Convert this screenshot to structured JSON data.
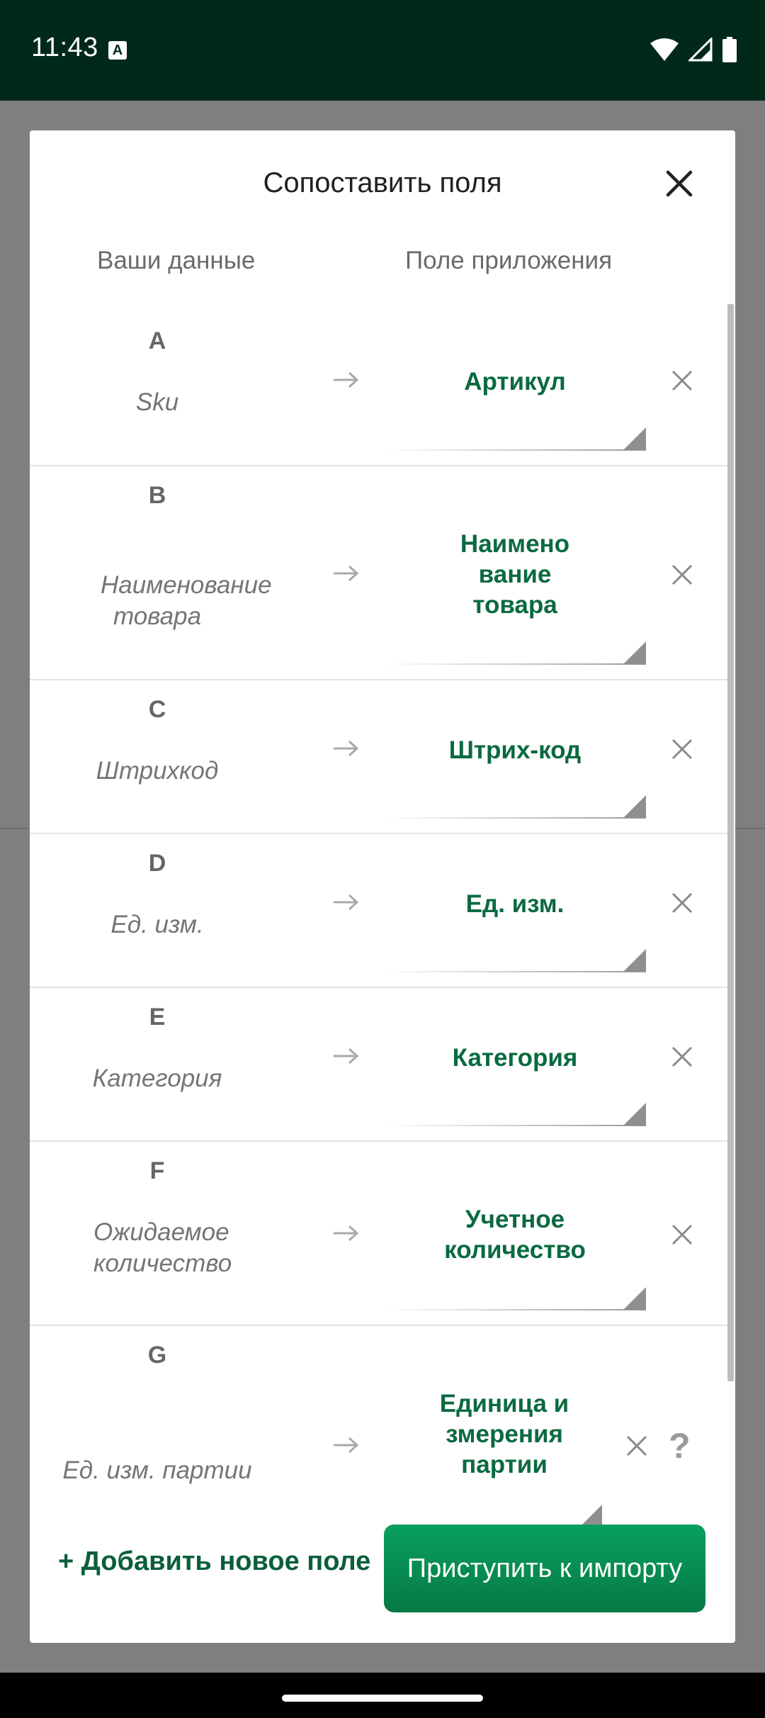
{
  "status_bar": {
    "time": "11:43",
    "notification_icon": "A",
    "icons": [
      "wifi-icon",
      "signal-icon",
      "battery-icon"
    ]
  },
  "dialog": {
    "title": "Сопоставить поля",
    "close_icon": "close-icon",
    "col_left": "Ваши данные",
    "col_right": "Поле приложения",
    "rows": [
      {
        "letter": "A",
        "source": "Sku",
        "target": "Артикул"
      },
      {
        "letter": "B",
        "source": "Наименование товара",
        "target": "Наимено вание товара"
      },
      {
        "letter": "C",
        "source": "Штрихкод",
        "target": "Штрих-код"
      },
      {
        "letter": "D",
        "source": "Ед. изм.",
        "target": "Ед. изм."
      },
      {
        "letter": "E",
        "source": "Категория",
        "target": "Категория"
      },
      {
        "letter": "F",
        "source": "Ожидаемое количество",
        "target": "Учетное количество"
      },
      {
        "letter": "G",
        "source": "Ед. изм. партии",
        "target": "Единица и змерения партии",
        "help": "?"
      }
    ],
    "add_field_label": "+ Добавить новое поле",
    "import_label": "Приступить к импорту"
  },
  "colors": {
    "status_bar": "#00291a",
    "accent_text": "#0a6a3f",
    "button": "#078a4f"
  }
}
